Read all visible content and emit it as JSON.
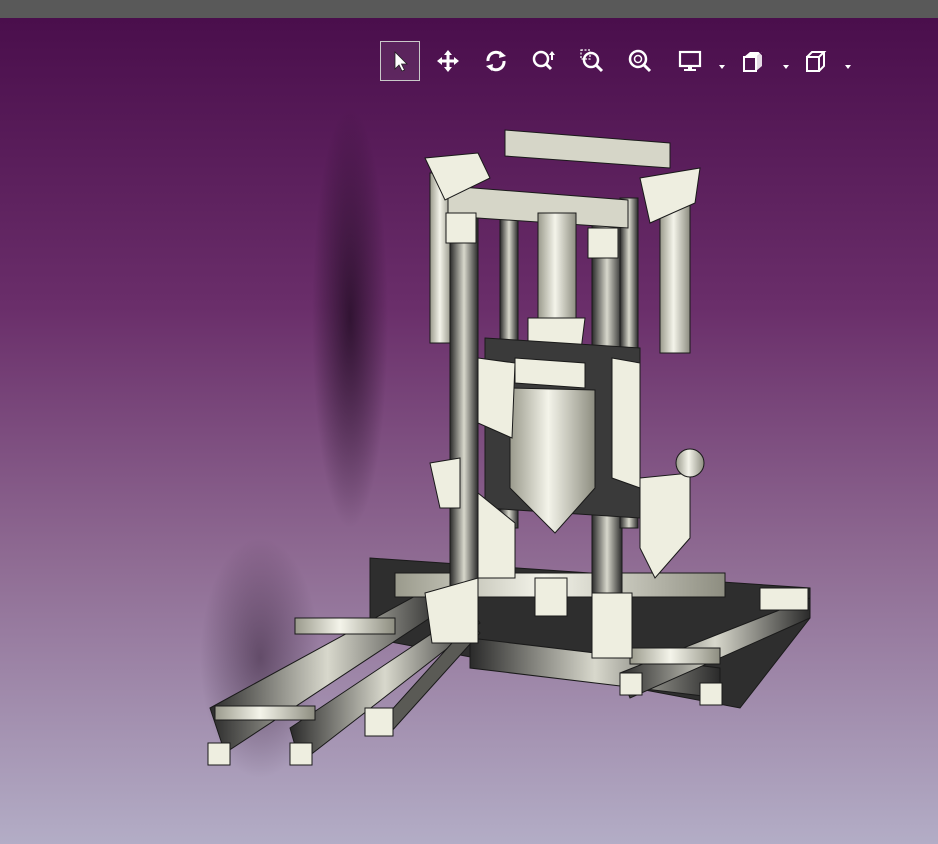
{
  "window": {
    "titlebar_color": "#595959"
  },
  "viewport": {
    "background_top": "#4a0e4c",
    "background_bottom": "#b3adc6"
  },
  "toolbar": {
    "buttons": [
      {
        "icon": "select-arrow-icon",
        "active": true
      },
      {
        "icon": "pan-move-icon",
        "active": false
      },
      {
        "icon": "rotate-icon",
        "active": false
      },
      {
        "icon": "zoom-in-out-icon",
        "active": false
      },
      {
        "icon": "zoom-box-icon",
        "active": false
      },
      {
        "icon": "zoom-fit-icon",
        "active": false
      },
      {
        "icon": "display-mode-icon",
        "active": false,
        "has_dropdown": true
      },
      {
        "icon": "section-clipping-icon",
        "active": false,
        "has_dropdown": true
      },
      {
        "icon": "view-cube-icon",
        "active": false,
        "has_dropdown": true
      }
    ]
  },
  "model": {
    "description_icon": "cad-assembly-model",
    "part_color": "#eeeee0",
    "edge_color": "#1a1a1a"
  }
}
